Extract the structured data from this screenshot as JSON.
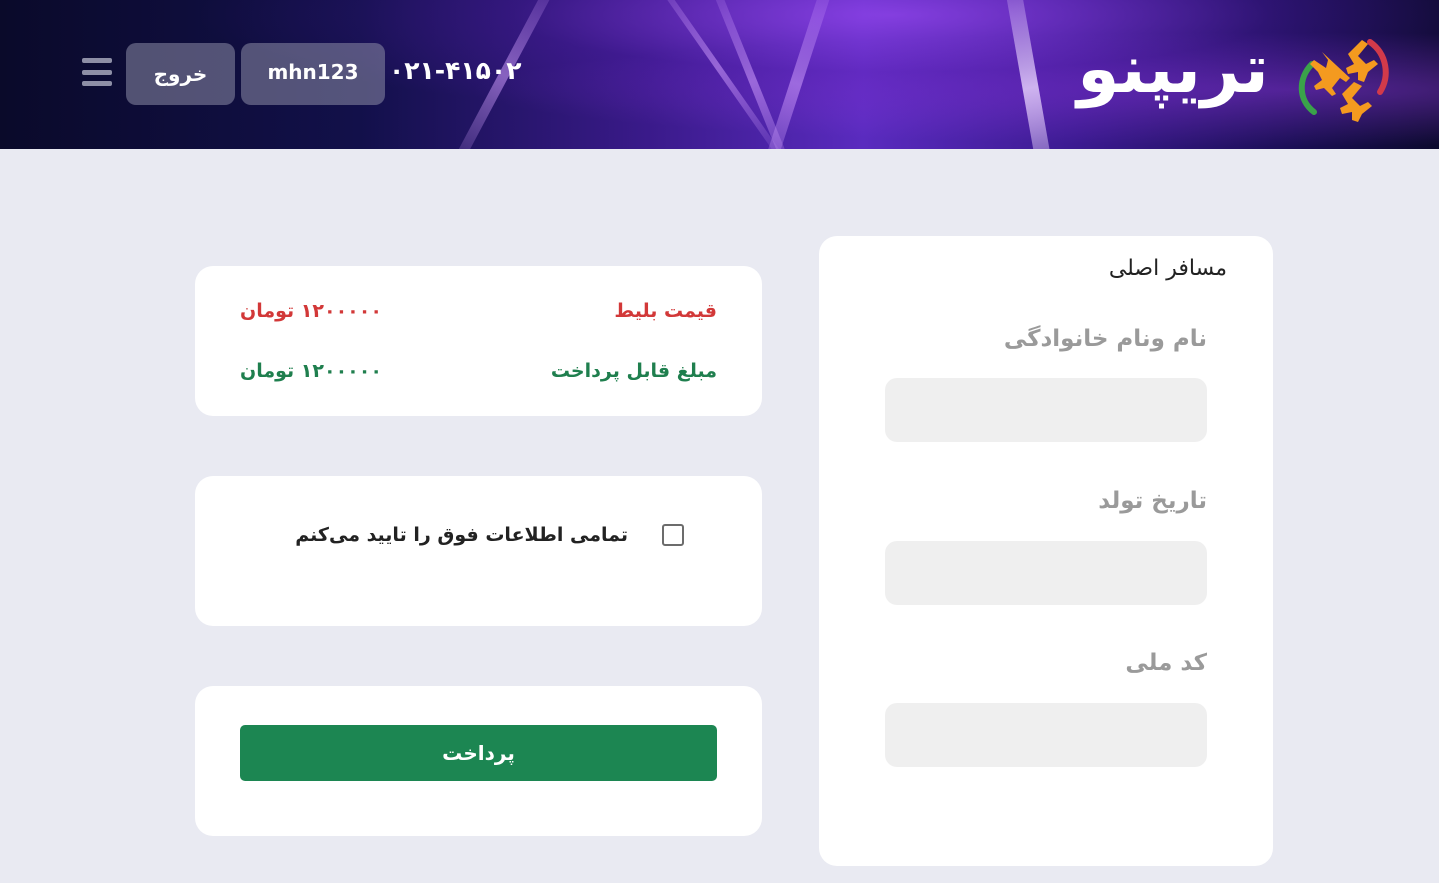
{
  "header": {
    "brand": "تریپنو",
    "phone": "۰۲۱-۴۱۵۰۲",
    "username": "mhn123",
    "logout_label": "خروج",
    "menu_icon": "hamburger-menu-icon",
    "logo_icon": "airplanes-logo-icon"
  },
  "passenger": {
    "title": "مسافر اصلی",
    "fields": [
      {
        "label": "نام ونام خانوادگی",
        "value": ""
      },
      {
        "label": "تاریخ تولد",
        "value": ""
      },
      {
        "label": "کد ملی",
        "value": ""
      }
    ]
  },
  "price": {
    "ticket_label": "قیمت بلیط",
    "ticket_value": "۱۲۰۰۰۰۰ تومان",
    "payable_label": "مبلغ قابل پرداخت",
    "payable_value": "۱۲۰۰۰۰۰ تومان"
  },
  "confirm": {
    "text": "تمامی اطلاعات فوق را تایید می‌کنم",
    "checked": false
  },
  "payment": {
    "button_label": "پرداخت"
  },
  "colors": {
    "page_bg": "#e9eaf2",
    "price_red": "#d23838",
    "payable_green": "#1f7f4e",
    "pay_button": "#1c8652"
  }
}
